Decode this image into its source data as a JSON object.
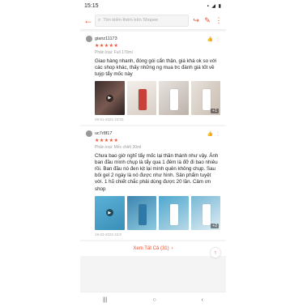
{
  "status_bar": {
    "time": "15:15",
    "icons": "▪ ◢ ▮"
  },
  "topbar": {
    "search_placeholder": "Tìm kiếm thêm trên Shopee"
  },
  "reviews": [
    {
      "username": "gianz11173",
      "stars": "★★★★★",
      "variant": "Phân loại: Full 170ml",
      "text": "Giao hàng nhanh, đóng gói cẩn thận, giá khá ok so với các shop khác, thấy những ng mua trc đánh giá tốt về tuýp tẩy mốc này",
      "more_photos": "+1",
      "date": "09-01-2022 23:03"
    },
    {
      "username": "uc7r8f17",
      "stars": "★★★★★",
      "variant": "Phân loại: Mốc chiết 30ml",
      "text": "Chưa bao giờ nghĩ tẩy mốc lại thần thánh như vậy. Ảnh ban đầu mình chụp là tẩy qua 1 đêm là đỡ đi bao nhiêu rồi. Ban đầu nó đen kịt lại mình quên không chụp. Sau bôi gel 2 ngày là nó được như hình. Sản phẩm tuyệt vời. 1 hũ chiết chắc phải dùng được 20 lần. Cảm ơn shop",
      "more_photos": "+2",
      "date": "19-03-2022 22:0"
    }
  ],
  "see_all": {
    "label": "Xem Tất Cả (31)"
  },
  "colors": {
    "accent": "#ee4d2d"
  }
}
